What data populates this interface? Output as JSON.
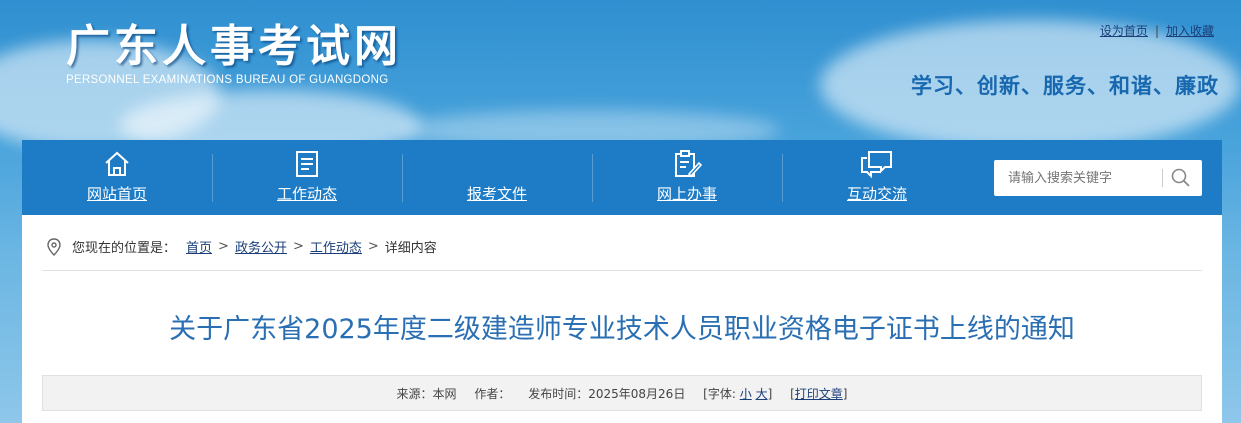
{
  "header": {
    "logo_cn": "广东人事考试网",
    "logo_en": "PERSONNEL EXAMINATIONS BUREAU OF GUANGDONG",
    "slogan": "学习、创新、服务、和谐、廉政",
    "top_links": {
      "homepage": "设为首页",
      "separator": "|",
      "favorite": "加入收藏"
    }
  },
  "nav": {
    "items": [
      {
        "label": "网站首页",
        "icon": "home-icon"
      },
      {
        "label": "工作动态",
        "icon": "document-list-icon"
      },
      {
        "label": "报考文件",
        "icon": ""
      },
      {
        "label": "网上办事",
        "icon": "clipboard-edit-icon"
      },
      {
        "label": "互动交流",
        "icon": "chat-bubbles-icon"
      }
    ],
    "search": {
      "placeholder": "请输入搜索关键字",
      "icon": "search-icon"
    }
  },
  "breadcrumb": {
    "prefix": "您现在的位置是：",
    "items": [
      "首页",
      "政务公开",
      "工作动态"
    ],
    "current": "详细内容",
    "separator": ">"
  },
  "article": {
    "title": "关于广东省2025年度二级建造师专业技术人员职业资格电子证书上线的通知",
    "meta": {
      "source_label": "来源：",
      "source": "本网",
      "author_label": "作者：",
      "date_label": "发布时间：",
      "date": "2025年08月26日",
      "font_label": "[字体:",
      "font_small": "小",
      "font_large": "大",
      "font_close": "]",
      "print_open": "[",
      "print": "打印文章",
      "print_close": "]"
    }
  },
  "colors": {
    "nav_bg": "#1e7cc6",
    "title": "#2a6fb3",
    "slogan": "#1868b0"
  }
}
